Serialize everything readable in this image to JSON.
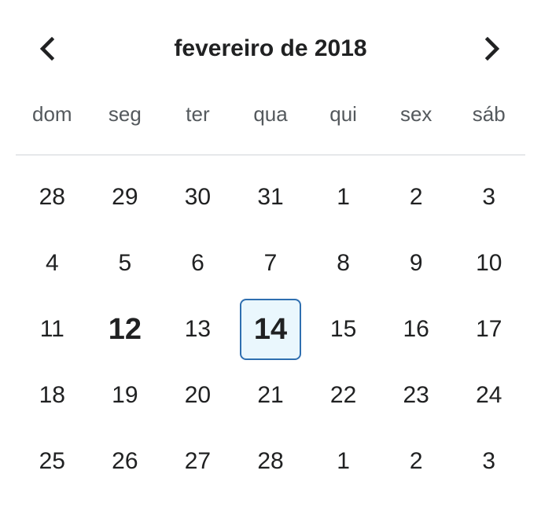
{
  "header": {
    "title": "fevereiro de 2018",
    "prev_icon": "chevron-left-icon",
    "next_icon": "chevron-right-icon"
  },
  "weekdays": [
    "dom",
    "seg",
    "ter",
    "qua",
    "qui",
    "sex",
    "sáb"
  ],
  "weeks": [
    [
      {
        "label": "28",
        "state": "normal"
      },
      {
        "label": "29",
        "state": "normal"
      },
      {
        "label": "30",
        "state": "normal"
      },
      {
        "label": "31",
        "state": "normal"
      },
      {
        "label": "1",
        "state": "normal"
      },
      {
        "label": "2",
        "state": "normal"
      },
      {
        "label": "3",
        "state": "normal"
      }
    ],
    [
      {
        "label": "4",
        "state": "normal"
      },
      {
        "label": "5",
        "state": "normal"
      },
      {
        "label": "6",
        "state": "normal"
      },
      {
        "label": "7",
        "state": "normal"
      },
      {
        "label": "8",
        "state": "normal"
      },
      {
        "label": "9",
        "state": "normal"
      },
      {
        "label": "10",
        "state": "normal"
      }
    ],
    [
      {
        "label": "11",
        "state": "normal"
      },
      {
        "label": "12",
        "state": "today"
      },
      {
        "label": "13",
        "state": "normal"
      },
      {
        "label": "14",
        "state": "selected"
      },
      {
        "label": "15",
        "state": "normal"
      },
      {
        "label": "16",
        "state": "normal"
      },
      {
        "label": "17",
        "state": "normal"
      }
    ],
    [
      {
        "label": "18",
        "state": "normal"
      },
      {
        "label": "19",
        "state": "normal"
      },
      {
        "label": "20",
        "state": "normal"
      },
      {
        "label": "21",
        "state": "normal"
      },
      {
        "label": "22",
        "state": "normal"
      },
      {
        "label": "23",
        "state": "normal"
      },
      {
        "label": "24",
        "state": "normal"
      }
    ],
    [
      {
        "label": "25",
        "state": "normal"
      },
      {
        "label": "26",
        "state": "normal"
      },
      {
        "label": "27",
        "state": "normal"
      },
      {
        "label": "28",
        "state": "normal"
      },
      {
        "label": "1",
        "state": "normal"
      },
      {
        "label": "2",
        "state": "normal"
      },
      {
        "label": "3",
        "state": "normal"
      }
    ]
  ],
  "colors": {
    "text": "#202122",
    "weekday_text": "#54595d",
    "selected_background": "#eaf7fd",
    "selected_border": "#2f6fb0",
    "divider": "#e6e8ea"
  }
}
